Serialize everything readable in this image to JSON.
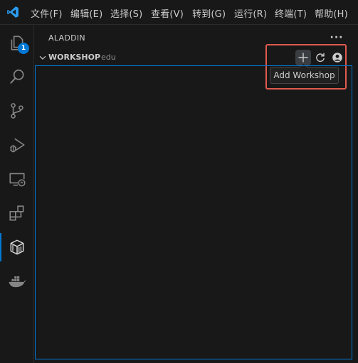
{
  "menu": {
    "items": [
      "文件(F)",
      "编辑(E)",
      "选择(S)",
      "查看(V)",
      "转到(G)",
      "运行(R)",
      "终端(T)",
      "帮助(H)"
    ]
  },
  "activity_bar": {
    "icons": [
      "explorer-icon",
      "search-icon",
      "source-control-icon",
      "run-debug-icon",
      "remote-explorer-icon",
      "extensions-icon",
      "aladdin-icon",
      "docker-icon"
    ],
    "explorer_badge": "1",
    "active": "aladdin-icon"
  },
  "sidebar": {
    "title": "ALADDIN",
    "more_label": "···",
    "section": {
      "title": "WORKSHOP",
      "description": "edu",
      "actions": [
        "add-icon",
        "refresh-icon",
        "account-icon"
      ]
    },
    "tooltip": "Add Workshop"
  },
  "colors": {
    "accent": "#0078d4",
    "highlight": "#e05a4e",
    "background": "#181818"
  }
}
